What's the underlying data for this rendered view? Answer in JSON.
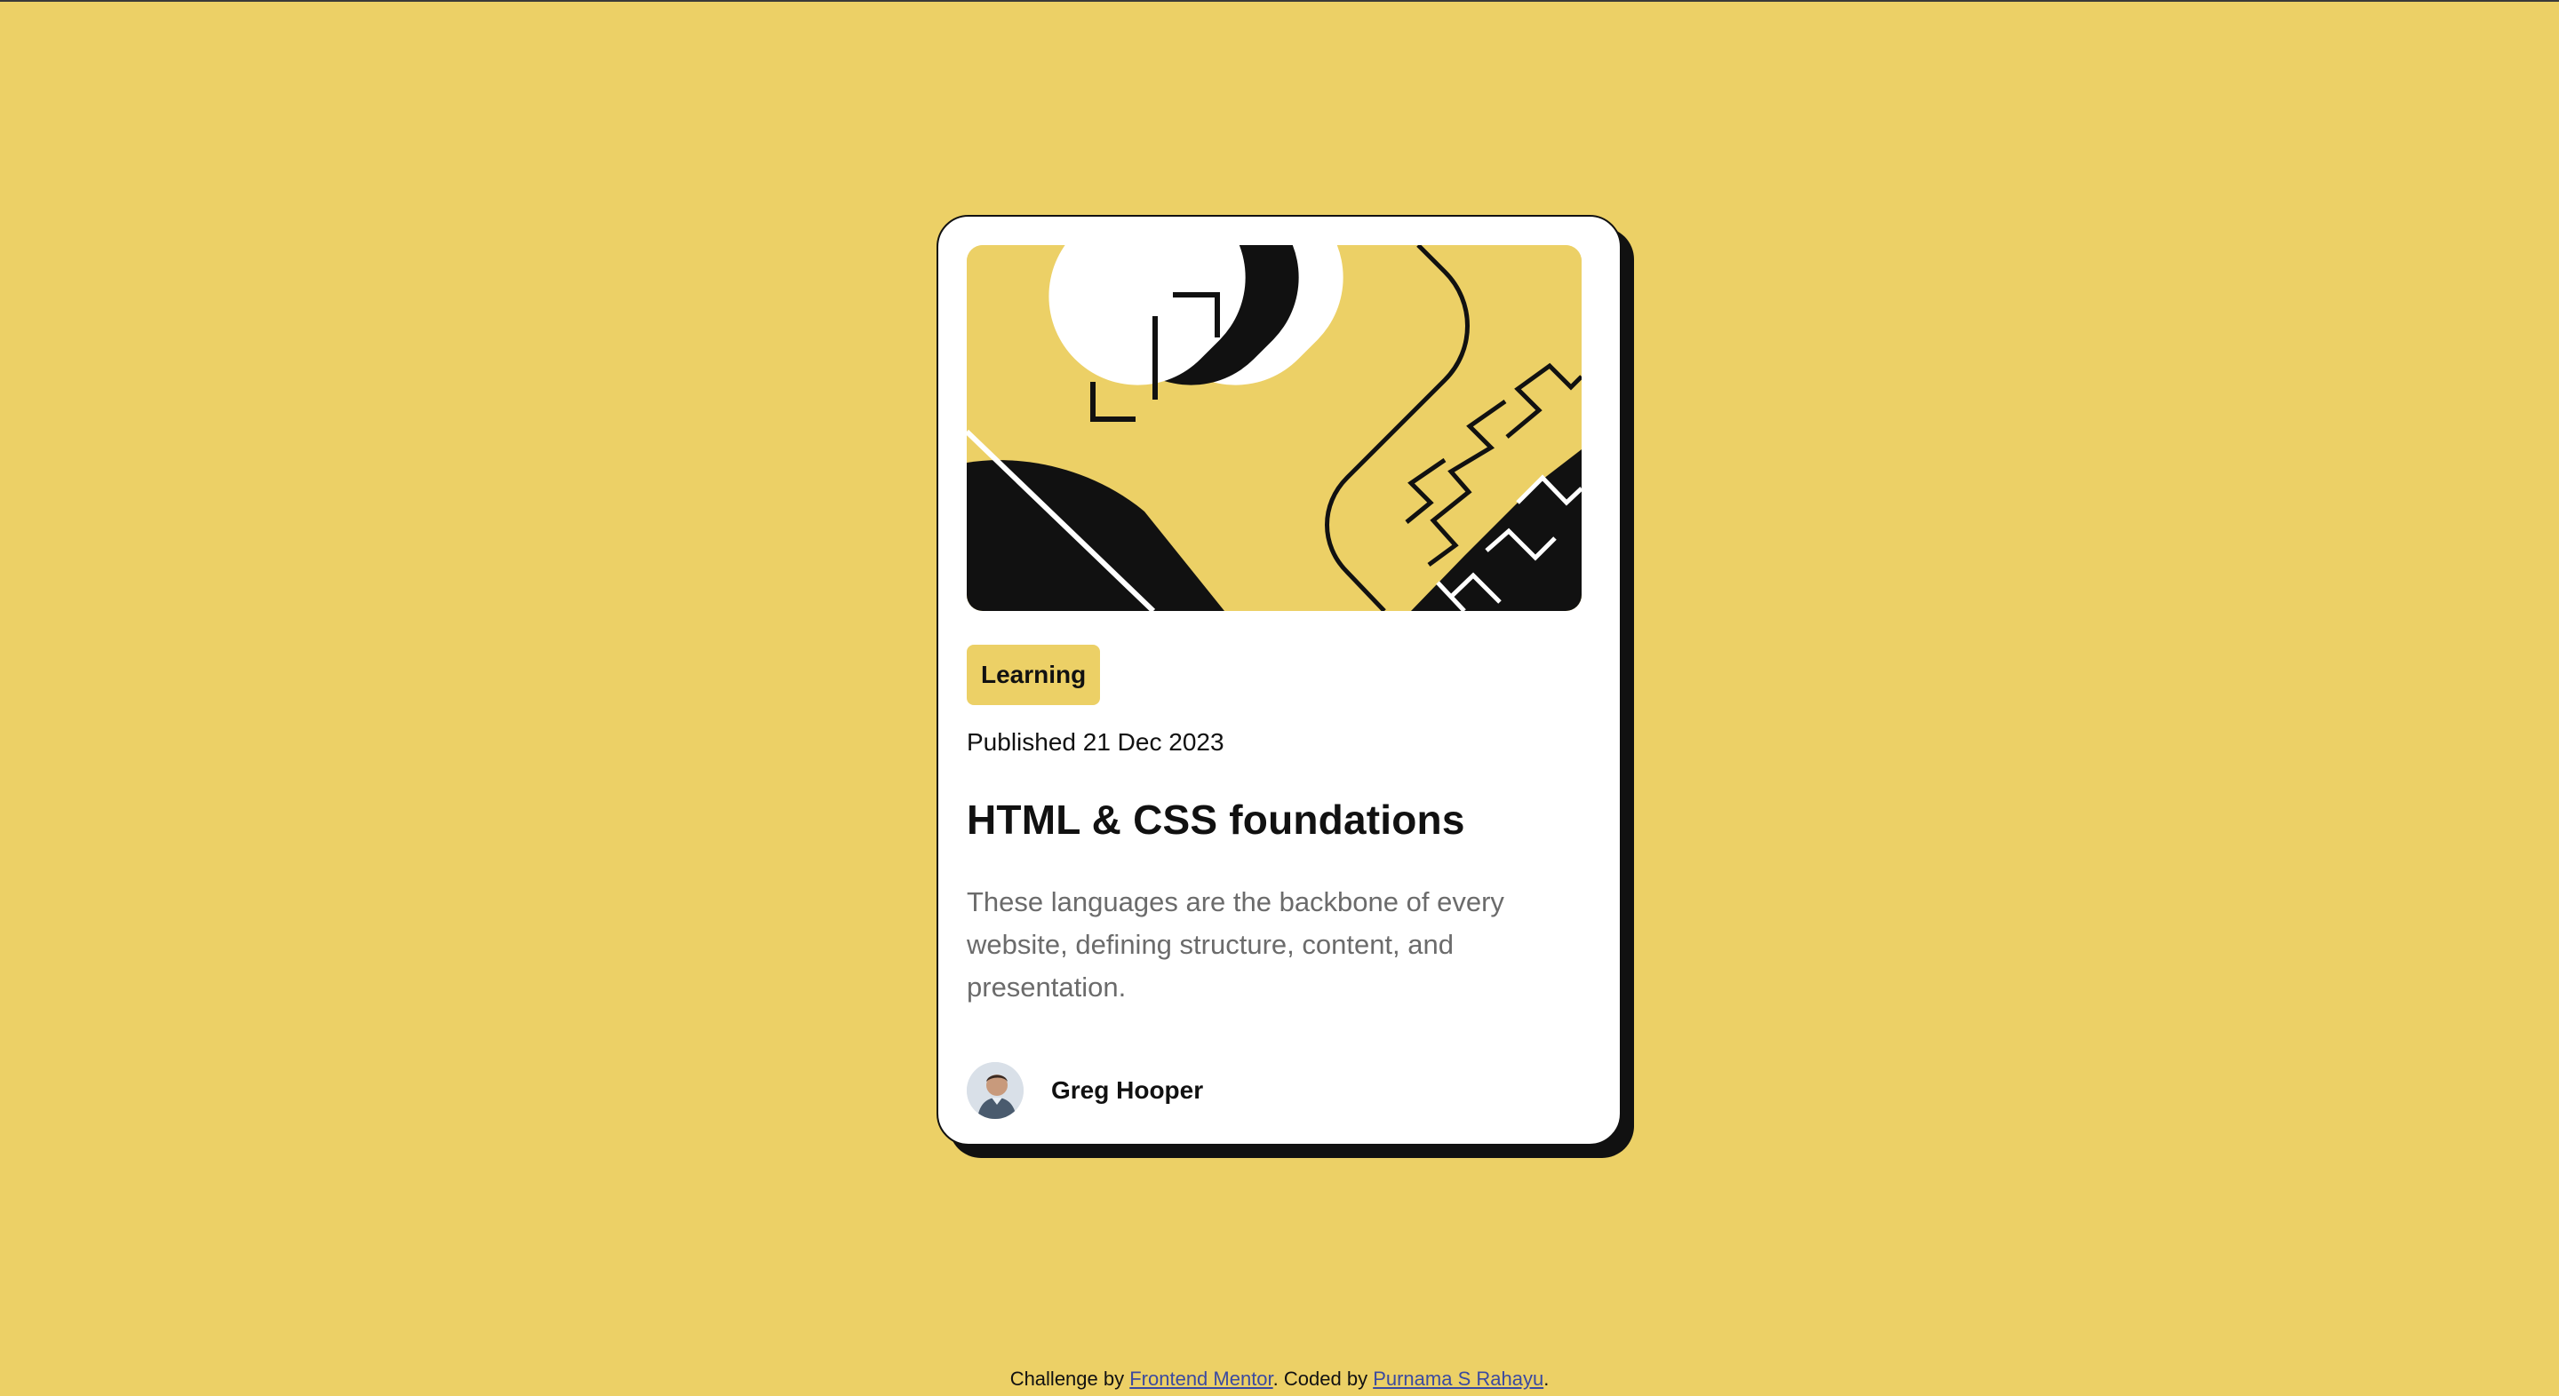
{
  "card": {
    "tag": "Learning",
    "published": "Published 21 Dec 2023",
    "title": "HTML & CSS foundations",
    "description": "These languages are the backbone of every website, defining structure, content, and presentation.",
    "author": "Greg Hooper"
  },
  "footer": {
    "prefix": "Challenge by ",
    "link1": "Frontend Mentor",
    "middle": ". Coded by ",
    "link2": "Purnama S Rahayu",
    "suffix": "."
  },
  "colors": {
    "background": "#ECD066",
    "card": "#FFFFFF",
    "ink": "#111111",
    "muted": "#6B6B6B",
    "link": "#3B4AA0"
  },
  "icons": {
    "hero": "abstract-illustration",
    "avatar": "author-avatar"
  }
}
